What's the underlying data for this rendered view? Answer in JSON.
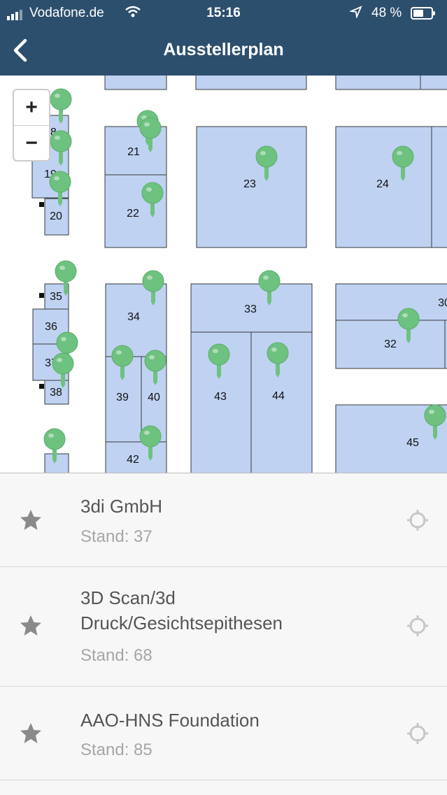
{
  "status_bar": {
    "carrier": "Vodafone.de",
    "time": "15:16",
    "battery": "48 %"
  },
  "header": {
    "title": "Ausstellerplan",
    "back_icon": "chevron-left-icon"
  },
  "map": {
    "zoom_in_label": "+",
    "zoom_out_label": "−",
    "booth_fill": "#bfd2f2",
    "pin_color": "#6ec27f",
    "booths": [
      "18",
      "19",
      "20",
      "21",
      "22",
      "23",
      "24",
      "35",
      "36",
      "37",
      "38",
      "34",
      "33",
      "30",
      "32",
      "39",
      "40",
      "42",
      "43",
      "44",
      "45"
    ]
  },
  "exhibitors": [
    {
      "name": "3di GmbH",
      "stand": "Stand: 37"
    },
    {
      "name": "3D Scan/3d Druck/Gesichtsepithesen",
      "name_lines": [
        "3D Scan/3d",
        "Druck/Gesichtsepithesen"
      ],
      "stand": "Stand: 68"
    },
    {
      "name": "AAO-HNS Foundation",
      "stand": "Stand: 85"
    }
  ]
}
